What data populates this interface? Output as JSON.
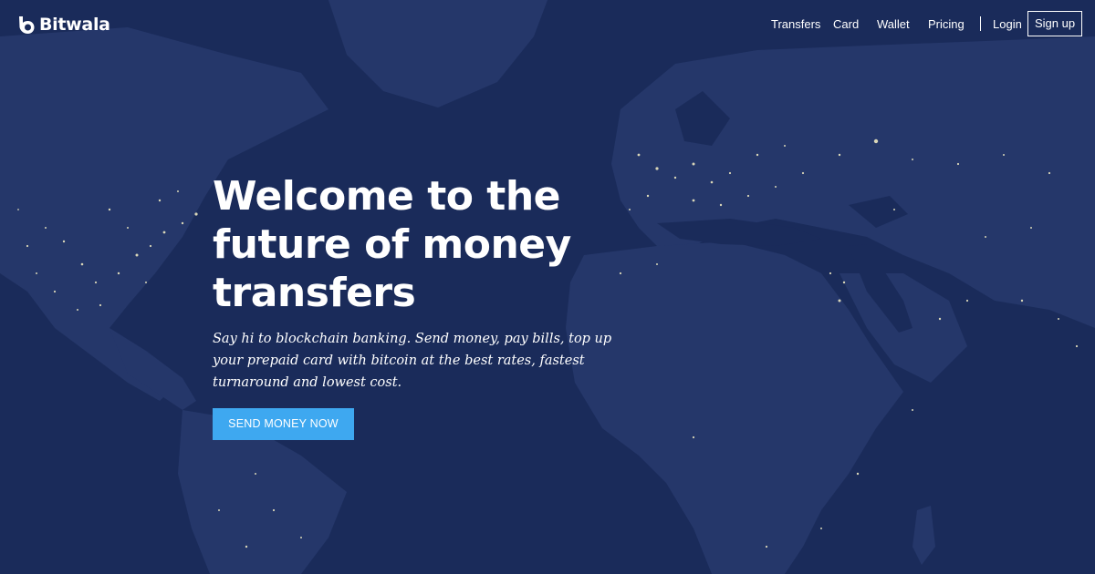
{
  "brand": {
    "name": "Bitwala"
  },
  "nav": {
    "transfers": "Transfers",
    "card": "Card",
    "wallet": "Wallet",
    "pricing": "Pricing",
    "login": "Login",
    "signup": "Sign up"
  },
  "hero": {
    "title": "Welcome to the future of money transfers",
    "subtitle": "Say hi to blockchain banking. Send money, pay bills, top up your prepaid card with bitcoin at the best rates, fastest turnaround and lowest cost.",
    "cta": "SEND MONEY NOW"
  },
  "colors": {
    "ocean": "#1a2b5a",
    "land": "#2a3f74",
    "city_lights": "#d9d6b8",
    "accent": "#3ea8f0",
    "text": "#ffffff"
  },
  "icons": {
    "logo": "bitwala-b-logo-icon"
  }
}
